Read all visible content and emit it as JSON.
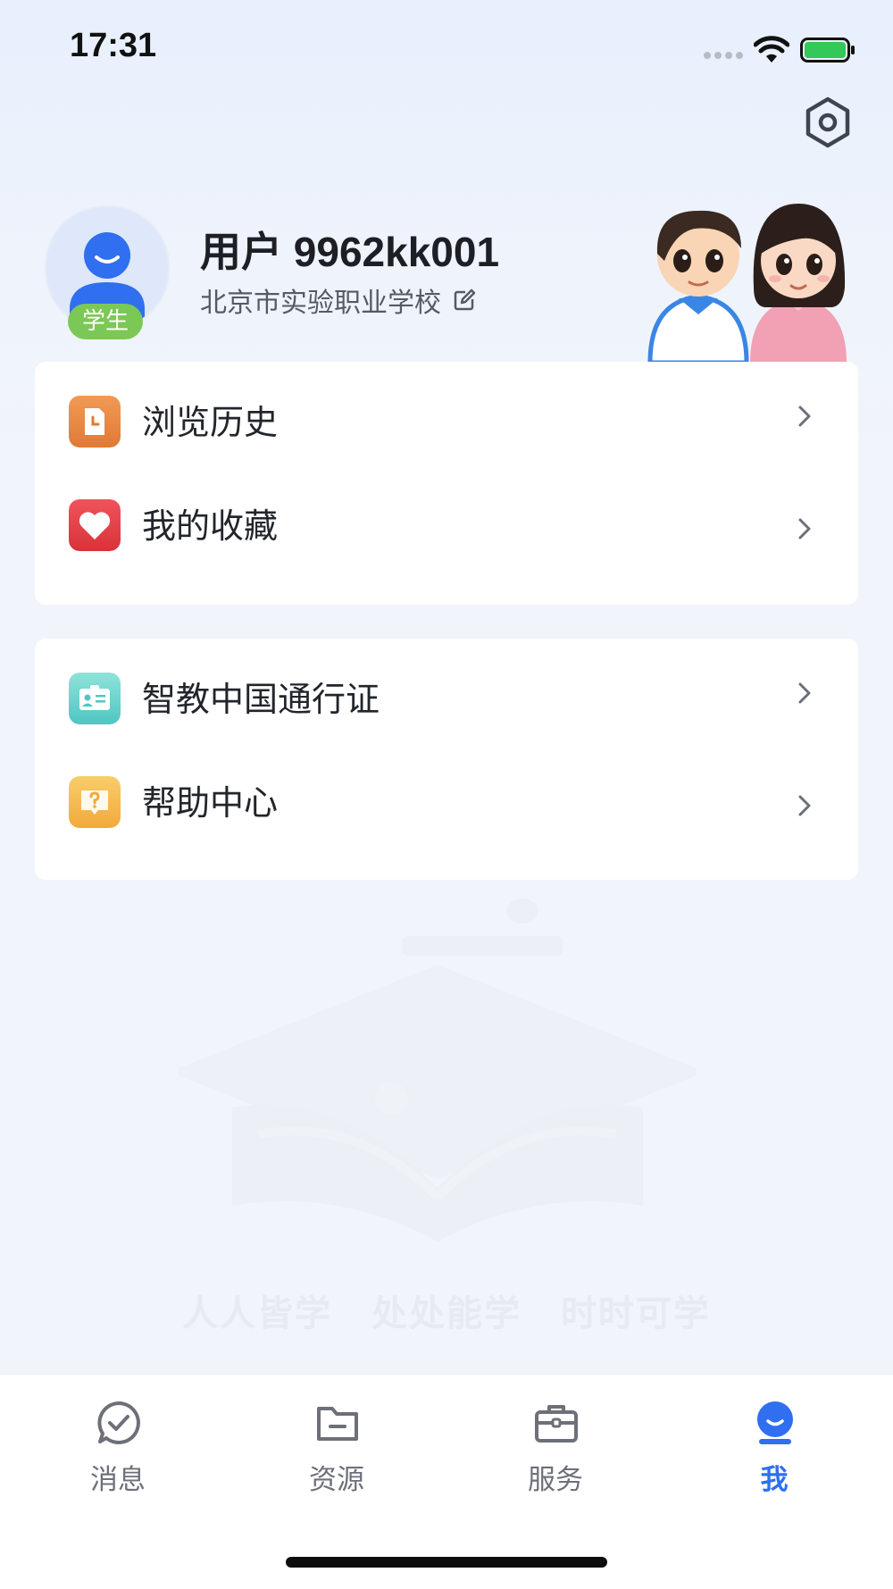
{
  "status_bar": {
    "time": "17:31",
    "signal_icon": "signal-dots-icon",
    "wifi_icon": "wifi-icon",
    "battery_icon": "battery-icon",
    "battery_color": "#34c759"
  },
  "header": {
    "settings_icon": "hexagon-settings-icon",
    "user": {
      "name": "用户 9962kk001",
      "school": "北京市实验职业学校",
      "role_badge": "学生",
      "avatar_icon": "person-avatar-icon",
      "edit_icon": "edit-icon"
    }
  },
  "menu_groups": [
    {
      "items": [
        {
          "label": "浏览历史",
          "icon": "history-icon",
          "icon_color": "#eb8a3f"
        },
        {
          "label": "我的收藏",
          "icon": "heart-icon",
          "icon_color": "#e8424a"
        }
      ]
    },
    {
      "items": [
        {
          "label": "智教中国通行证",
          "icon": "id-card-icon",
          "icon_color": "#5fd0c8"
        },
        {
          "label": "帮助中心",
          "icon": "help-icon",
          "icon_color": "#f4b84b"
        }
      ]
    }
  ],
  "watermark": {
    "slogan": [
      "人人皆学",
      "处处能学",
      "时时可学"
    ],
    "icon": "book-graduation-cap-icon"
  },
  "tab_bar": {
    "tabs": [
      {
        "label": "消息",
        "icon": "message-check-icon"
      },
      {
        "label": "资源",
        "icon": "folder-icon"
      },
      {
        "label": "服务",
        "icon": "briefcase-icon"
      },
      {
        "label": "我",
        "icon": "profile-icon",
        "active": true
      }
    ],
    "active_color": "#2f6ff0",
    "inactive_color": "#6d7079"
  }
}
